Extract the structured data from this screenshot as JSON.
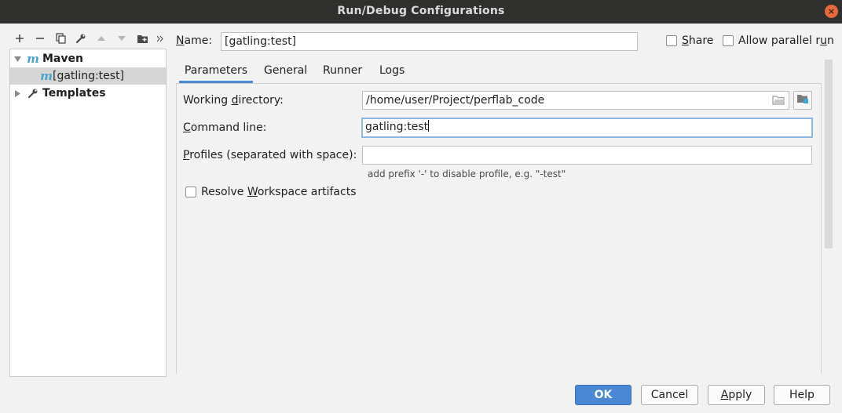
{
  "window": {
    "title": "Run/Debug Configurations",
    "close_glyph": "×"
  },
  "tree": {
    "items": [
      {
        "label": "Maven",
        "icon": "maven-icon",
        "expanded": true
      },
      {
        "label": "[gatling:test]",
        "icon": "maven-icon",
        "selected": true
      },
      {
        "label": "Templates",
        "icon": "wrench-icon",
        "expanded": false
      }
    ]
  },
  "name_row": {
    "label_first": "N",
    "label_rest": "ame:",
    "value": "[gatling:test]",
    "share_first": "S",
    "share_rest": "hare",
    "parallel_label": "Allow parallel r",
    "parallel_ul": "u",
    "parallel_end": "n"
  },
  "tabs": [
    {
      "label": "Parameters",
      "active": true
    },
    {
      "label": "General"
    },
    {
      "label": "Runner"
    },
    {
      "label": "Logs"
    }
  ],
  "params": {
    "workdir_a": "Working ",
    "workdir_ul": "d",
    "workdir_b": "irectory:",
    "workdir_value": "/home/user/Project/perflab_code",
    "cmd_ul": "C",
    "cmd_b": "ommand line:",
    "cmd_value": "gatling:test",
    "profiles_ul": "P",
    "profiles_b": "rofiles (separated with space):",
    "profiles_value": "",
    "profiles_hint": "add prefix '-' to disable profile, e.g. \"-test\"",
    "resolve_a": "Resolve ",
    "resolve_ul": "W",
    "resolve_b": "orkspace artifacts"
  },
  "buttons": {
    "ok": "OK",
    "cancel": "Cancel",
    "apply_ul": "A",
    "apply_rest": "pply",
    "help": "Help"
  },
  "colors": {
    "accent": "#4a88d6",
    "maven": "#4aa3c8",
    "titlebar": "#2f2f2d"
  }
}
